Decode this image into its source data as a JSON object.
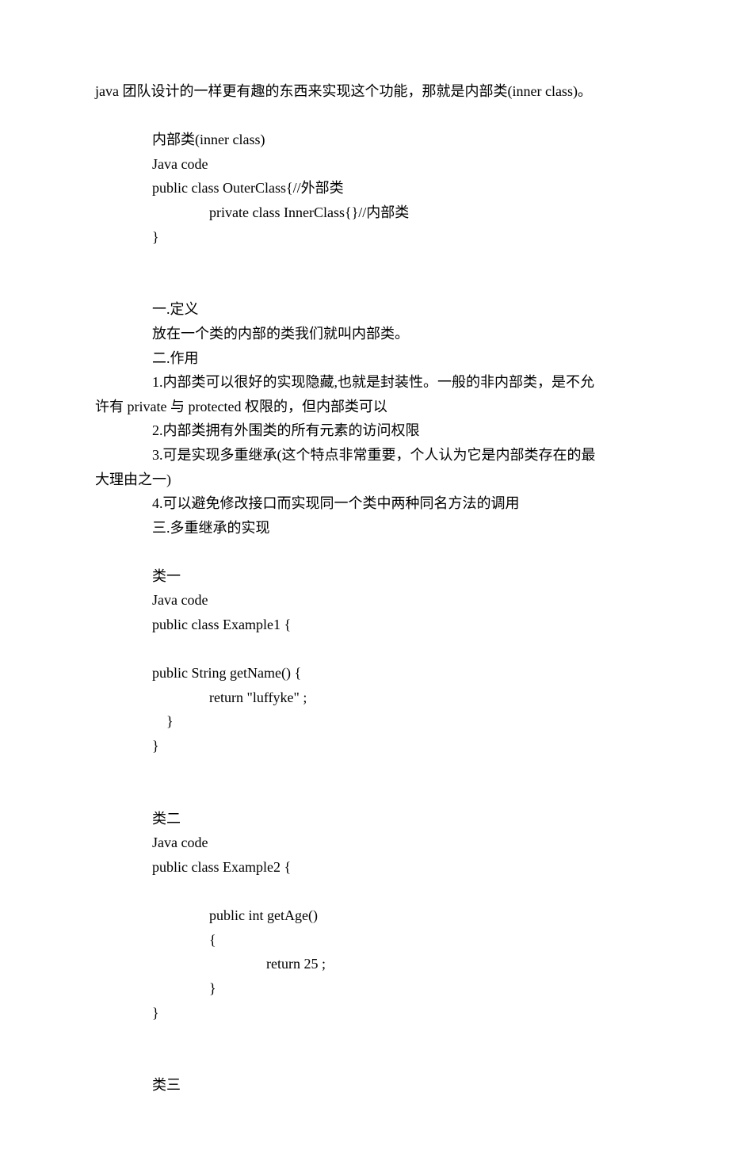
{
  "intro": {
    "line1": "java 团队设计的一样更有趣的东西来实现这个功能，那就是内部类(inner class)。"
  },
  "section1": {
    "title": "内部类(inner class)",
    "codeLabel": "Java code",
    "codeLine1": "public class OuterClass{//外部类",
    "codeLine2": "private class InnerClass{}//内部类",
    "codeLine3": "}"
  },
  "def": {
    "h1": "一.定义",
    "p1": "放在一个类的内部的类我们就叫内部类。",
    "h2": "二.作用",
    "p2a": "1.内部类可以很好的实现隐藏,也就是封装性。一般的非内部类，是不允",
    "p2b": "许有 private 与 protected 权限的，但内部类可以",
    "p3": "2.内部类拥有外围类的所有元素的访问权限",
    "p4a": "3.可是实现多重继承(这个特点非常重要，个人认为它是内部类存在的最",
    "p4b": "大理由之一)",
    "p5": "4.可以避免修改接口而实现同一个类中两种同名方法的调用",
    "h3": "三.多重继承的实现"
  },
  "class1": {
    "title": "类一",
    "codeLabel": "Java code",
    "line1": "public    class   Example1 {",
    "line2": "public   String getName()   {",
    "line3": "return    \"luffyke\" ;",
    "line4": "}",
    "line5": "}"
  },
  "class2": {
    "title": "类二",
    "codeLabel": "Java code",
    "line1": "public    class   Example2 {",
    "line2": "public    int   getAge()",
    "line3": "{",
    "line4": "return    25 ;",
    "line5": "}",
    "line6": "}"
  },
  "class3": {
    "title": "类三"
  }
}
